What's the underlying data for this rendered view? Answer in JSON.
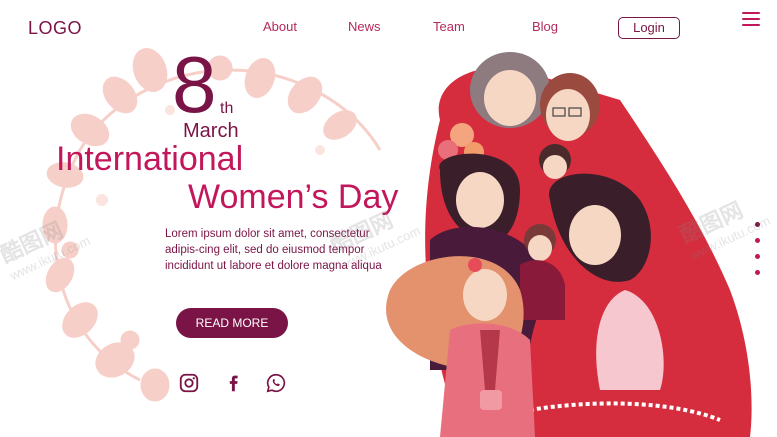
{
  "header": {
    "logo": "LOGO",
    "nav": [
      {
        "label": "About"
      },
      {
        "label": "News"
      },
      {
        "label": "Team"
      },
      {
        "label": "Blog"
      }
    ],
    "login_label": "Login",
    "menu_icon": "hamburger-menu-icon"
  },
  "hero": {
    "date_number": "8",
    "date_suffix": "th",
    "month": "March",
    "title_line1": "International",
    "title_line2": "Women’s Day",
    "description": "Lorem ipsum dolor sit amet, consectetur adipis-cing elit, sed do eiusmod tempor incididunt ut labore et dolore magna aliqua",
    "cta_label": "READ MORE"
  },
  "social": [
    {
      "icon": "instagram-icon"
    },
    {
      "icon": "facebook-icon"
    },
    {
      "icon": "whatsapp-icon"
    }
  ],
  "slider": {
    "count": 4,
    "active_index": 0
  },
  "watermark": {
    "brand": "酷图网",
    "url": "www.ikutu.com"
  },
  "colors": {
    "primary": "#7a1446",
    "accent": "#c2185b",
    "floral": "#f6c9c4"
  }
}
